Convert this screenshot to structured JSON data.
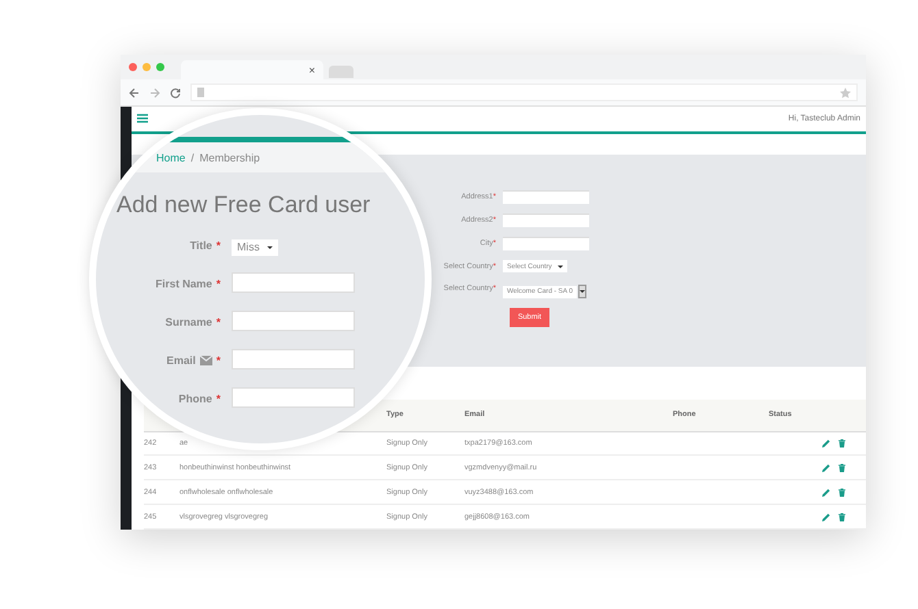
{
  "browser": {
    "tab_close": "×"
  },
  "header": {
    "greeting": "Hi, Tasteclub Admin"
  },
  "required_mark": "*",
  "magnifier": {
    "breadcrumb": [
      "Home",
      "Membership"
    ],
    "separator": "/",
    "title": "Add new Free Card user",
    "fields": [
      {
        "label": "Title",
        "kind": "select",
        "value": "Miss",
        "required": true
      },
      {
        "label": "First Name",
        "kind": "text",
        "required": true
      },
      {
        "label": "Surname",
        "kind": "text",
        "required": true
      },
      {
        "label": "Email",
        "kind": "email",
        "required": true
      },
      {
        "label": "Phone",
        "kind": "text",
        "required": true
      }
    ]
  },
  "form": {
    "fields": [
      {
        "label": "Address1",
        "kind": "text",
        "required": true
      },
      {
        "label": "Address2",
        "kind": "text",
        "required": true
      },
      {
        "label": "City",
        "kind": "text",
        "required": true
      },
      {
        "label": "Select Country",
        "kind": "select",
        "value": "Select Country",
        "required": true
      },
      {
        "label": "Select Country",
        "kind": "combo",
        "value": "Welcome Card - SA 0",
        "required": true
      }
    ],
    "submit": "Submit"
  },
  "table": {
    "columns": [
      "Type",
      "Email",
      "Phone",
      "Status"
    ],
    "rows": [
      {
        "id": "242",
        "name": "ae",
        "type": "Signup Only",
        "email": "txpa2179@163.com"
      },
      {
        "id": "243",
        "name": "honbeuthinwinst honbeuthinwinst",
        "type": "Signup Only",
        "email": "vgzmdvenyy@mail.ru"
      },
      {
        "id": "244",
        "name": "onflwholesale onflwholesale",
        "type": "Signup Only",
        "email": "vuyz3488@163.com"
      },
      {
        "id": "245",
        "name": "vlsgrovegreg vlsgrovegreg",
        "type": "Signup Only",
        "email": "gejj8608@163.com"
      }
    ]
  }
}
